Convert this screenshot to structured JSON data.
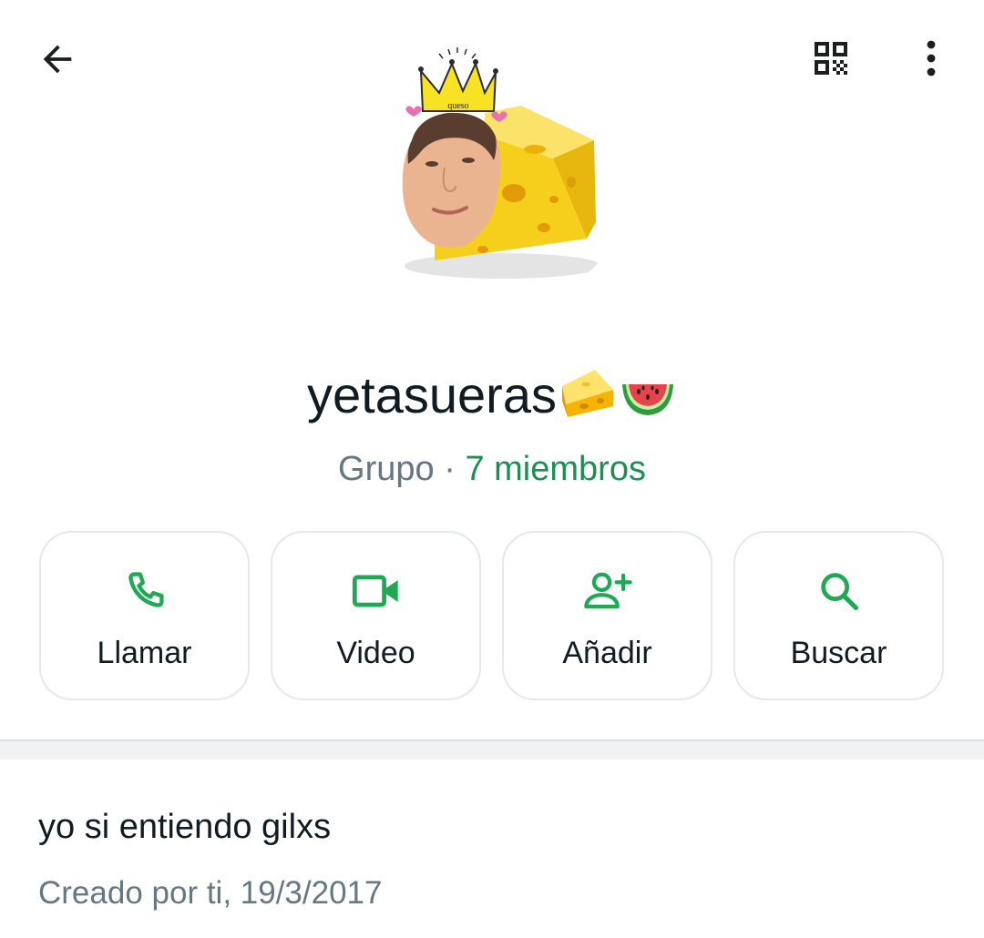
{
  "header": {
    "back_icon": "arrow-left-icon",
    "qr_icon": "qr-code-icon",
    "more_icon": "more-vert-icon"
  },
  "group": {
    "name": "yetasueras",
    "name_emojis": [
      "cheese-icon",
      "watermelon-icon"
    ],
    "type_label": "Grupo",
    "separator": " · ",
    "members_label": "7 miembros",
    "avatar_crown_text": "queso",
    "description": "yo si entiendo gilxs",
    "created_label": "Creado por ti, 19/3/2017"
  },
  "actions": [
    {
      "label": "Llamar",
      "icon": "phone-icon"
    },
    {
      "label": "Video",
      "icon": "video-icon"
    },
    {
      "label": "Añadir",
      "icon": "add-person-icon"
    },
    {
      "label": "Buscar",
      "icon": "search-icon"
    }
  ],
  "colors": {
    "accent": "#1d8f52",
    "icon_green": "#1fa855",
    "text_primary": "#111b21",
    "text_secondary": "#667781",
    "card_border": "#e6e8e9"
  }
}
